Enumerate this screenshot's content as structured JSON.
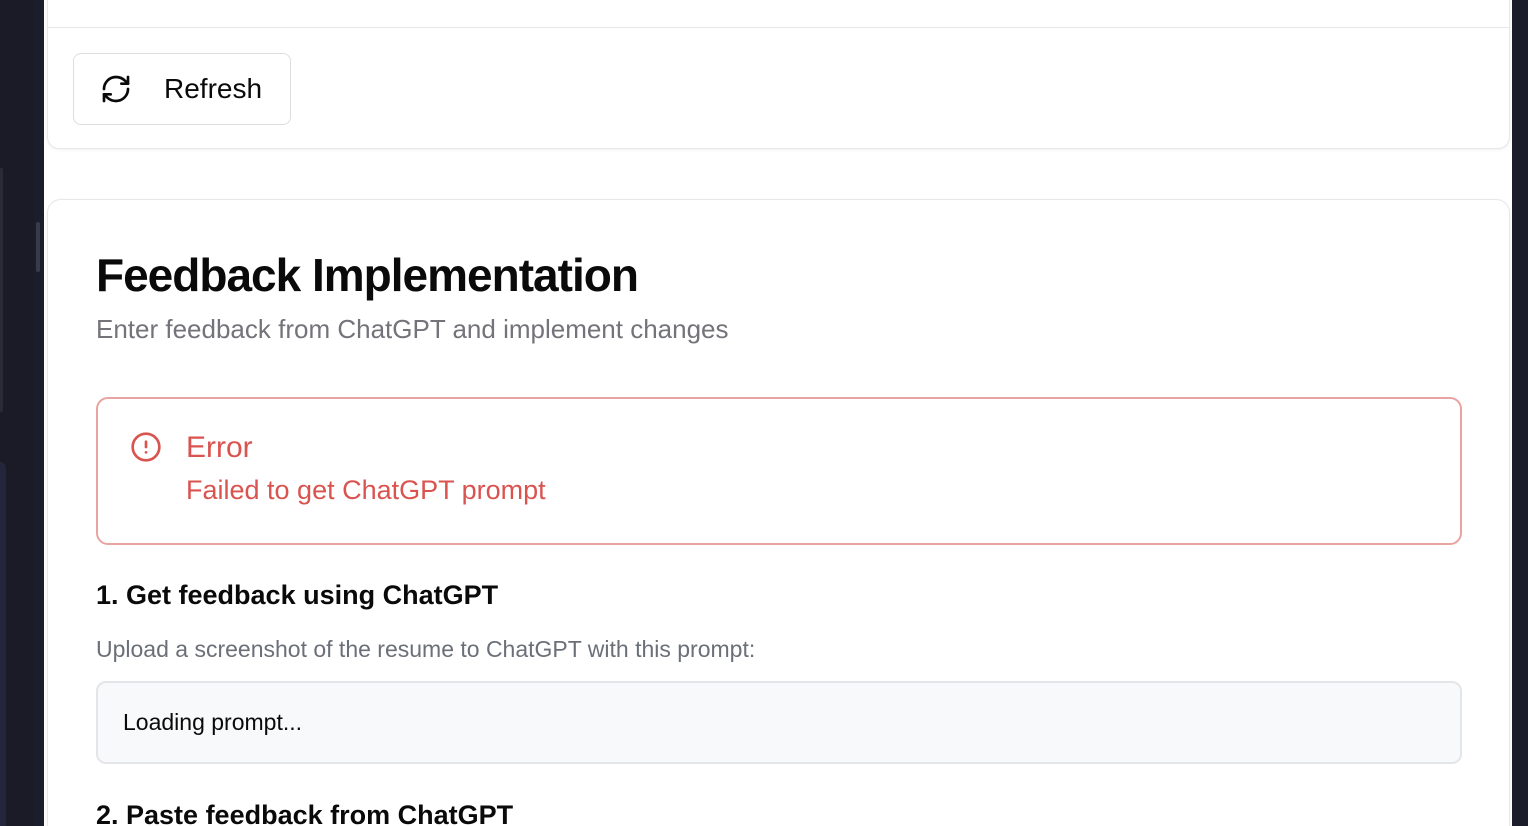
{
  "toolbar": {
    "refresh_label": "Refresh",
    "refresh_icon": "refresh-icon"
  },
  "feedback": {
    "title": "Feedback Implementation",
    "subtitle": "Enter feedback from ChatGPT and implement changes",
    "error": {
      "icon": "alert-circle-icon",
      "title": "Error",
      "message": "Failed to get ChatGPT prompt",
      "color": "#d9534f",
      "border_color": "#e9a3a1"
    },
    "step1": {
      "heading": "1. Get feedback using ChatGPT",
      "help": "Upload a screenshot of the resume to ChatGPT with this prompt:",
      "prompt_text": "Loading prompt..."
    },
    "step2": {
      "heading": "2. Paste feedback from ChatGPT"
    }
  },
  "colors": {
    "background_dark": "#1c1d2a",
    "card_background": "#ffffff",
    "muted_text": "#73737a",
    "prompt_background": "#f8f9fa"
  }
}
